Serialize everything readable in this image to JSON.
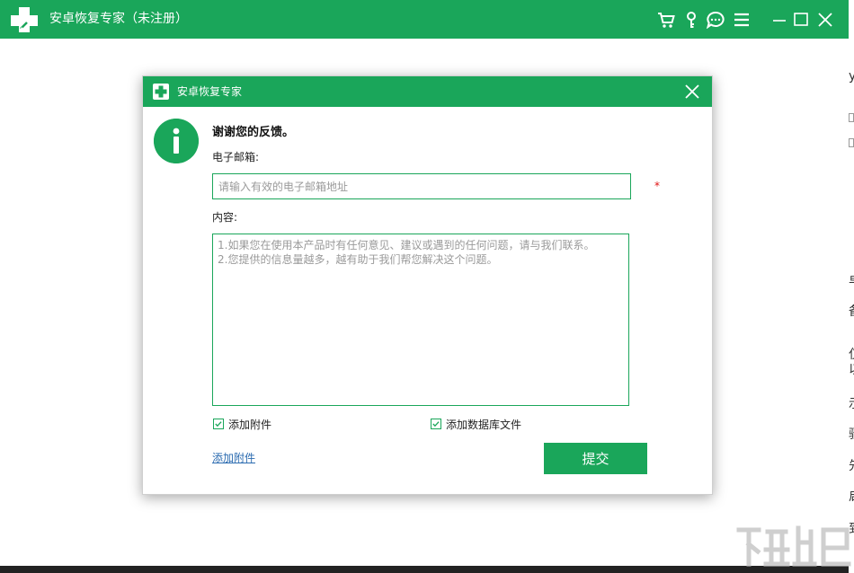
{
  "app": {
    "title": "安卓恢复专家（未注册）",
    "brand_color": "#1aa65a",
    "header_icons": [
      "cart-icon",
      "key-icon",
      "chat-icon",
      "menu-icon",
      "minimize-icon",
      "maximize-icon",
      "close-icon"
    ]
  },
  "dialog": {
    "title": "安卓恢复专家",
    "thanks_text": "谢谢您的反馈。",
    "email_label": "电子邮箱:",
    "email_placeholder": "请输入有效的电子邮箱地址",
    "required_mark": "*",
    "content_label": "内容:",
    "content_placeholder": "1.如果您在使用本产品时有任何意见、建议或遇到的任何问题，请与我们联系。\n2.您提供的信息量越多，越有助于我们帮您解决这个问题。",
    "checkbox_attachment": {
      "label": "添加附件",
      "checked": true
    },
    "checkbox_database": {
      "label": "添加数据库文件",
      "checked": true
    },
    "add_attachment_link": "添加附件",
    "submit_label": "提交"
  },
  "side_fragments": [
    "y",
    "卓",
    "备",
    "仅",
    "以",
    "示",
    "骤",
    "先",
    "启",
    "到"
  ]
}
